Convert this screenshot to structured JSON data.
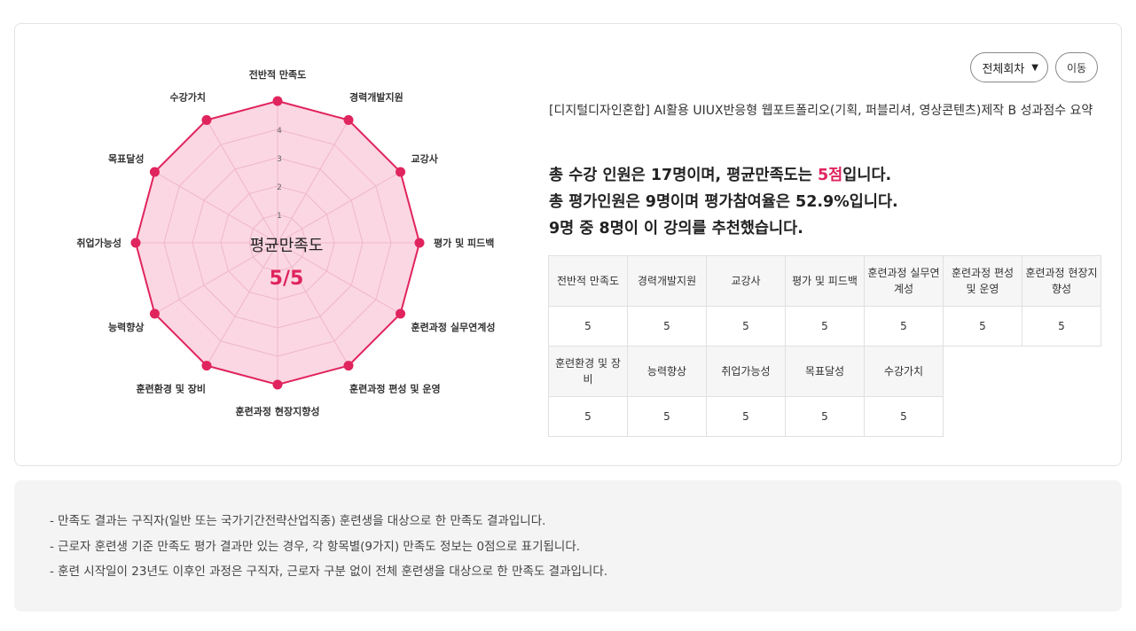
{
  "controls": {
    "round_select": "전체회차",
    "go_button": "이동"
  },
  "course_title": "[디지털디자인혼합] AI활용 UIUX반응형 웹포트폴리오(기획, 퍼블리셔, 영상콘텐츠)제작 B 성과점수 요약",
  "summary": {
    "line1_pre": "총 수강 인원은 17명이며, 평균만족도는 ",
    "line1_accent": "5점",
    "line1_post": "입니다.",
    "line2": "총 평가인원은 9명이며 평가참여율은 52.9%입니다.",
    "line3": "9명 중 8명이 이 강의를 추천했습니다."
  },
  "table": {
    "row1_headers": [
      "전반적 만족도",
      "경력개발지원",
      "교강사",
      "평가 및 피드백",
      "훈련과정 실무연계성",
      "훈련과정 편성 및 운영",
      "훈련과정 현장지향성"
    ],
    "row1_values": [
      "5",
      "5",
      "5",
      "5",
      "5",
      "5",
      "5"
    ],
    "row2_headers": [
      "훈련환경 및 장비",
      "능력향상",
      "취업가능성",
      "목표달성",
      "수강가치"
    ],
    "row2_values": [
      "5",
      "5",
      "5",
      "5",
      "5"
    ]
  },
  "notes": [
    "- 만족도 결과는 구직자(일반 또는 국가기간전략산업직종) 훈련생을 대상으로 한 만족도 결과입니다.",
    "- 근로자 훈련생 기준 만족도 평가 결과만 있는 경우, 각 항목별(9가지) 만족도 정보는 0점으로 표기됩니다.",
    "- 훈련 시작일이 23년도 이후인 과정은 구직자, 근로자 구분 없이 전체 훈련생을 대상으로 한 만족도 결과입니다."
  ],
  "colors": {
    "accent": "#e0245e",
    "fill": "#f9c9d9",
    "grid": "#e8b8c8"
  },
  "chart_data": {
    "type": "radar",
    "center_title": "평균만족도",
    "center_value": "5/5",
    "categories": [
      "전반적 만족도",
      "경력개발지원",
      "교강사",
      "평가 및 피드백",
      "훈련과정 실무연계성",
      "훈련과정 편성 및 운영",
      "훈련과정 현장지향성",
      "훈련환경 및 장비",
      "능력향상",
      "취업가능성",
      "목표달성",
      "수강가치"
    ],
    "values": [
      5,
      5,
      5,
      5,
      5,
      5,
      5,
      5,
      5,
      5,
      5,
      5
    ],
    "ticks": [
      "1",
      "2",
      "3",
      "4"
    ],
    "range": [
      0,
      5
    ]
  }
}
